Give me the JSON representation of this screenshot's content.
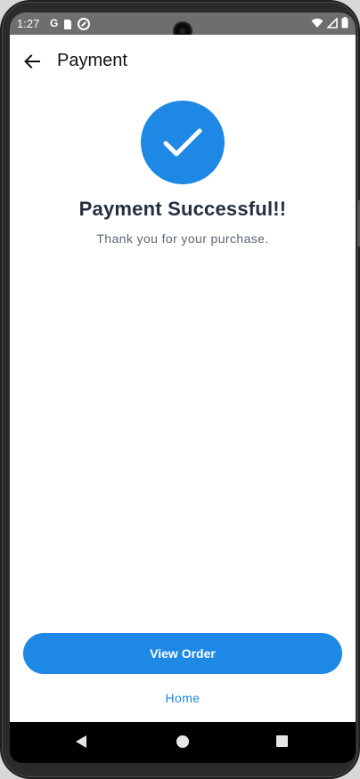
{
  "status_bar": {
    "time": "1:27",
    "left_icons": [
      "google-icon",
      "sd-card-icon",
      "data-saver-icon"
    ],
    "right_icons": [
      "wifi-icon",
      "signal-icon",
      "battery-icon"
    ],
    "google_glyph": "G"
  },
  "app_bar": {
    "title": "Payment",
    "back_icon": "arrow-left-icon"
  },
  "success": {
    "icon": "checkmark-icon",
    "title": "Payment Successful!!",
    "subtitle": "Thank you for your purchase."
  },
  "actions": {
    "view_order_label": "View Order",
    "home_label": "Home"
  },
  "nav_bar": {
    "back_icon": "triangle-back-icon",
    "home_icon": "circle-home-icon",
    "recents_icon": "square-recents-icon"
  },
  "colors": {
    "accent": "#1e88e5",
    "title_text": "#24303f",
    "subtitle_text": "#5b6775",
    "status_bar_bg": "#6e6e6e"
  }
}
